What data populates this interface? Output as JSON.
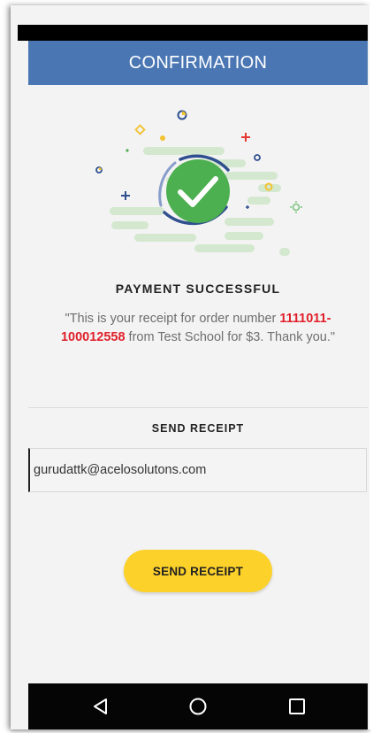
{
  "header": {
    "title": "CONFIRMATION"
  },
  "payment": {
    "status_title": "PAYMENT SUCCESSFUL",
    "message_prefix": "\"This is your receipt for order number ",
    "order_number": "1111011-100012558",
    "message_suffix": " from Test School for $3. Thank you.\""
  },
  "send_receipt": {
    "heading": "SEND RECEIPT",
    "email_value": "gurudattk@acelosolutons.com",
    "button_label": "SEND RECEIPT"
  },
  "navigation": {
    "items": [
      {
        "icon": "back-triangle-icon"
      },
      {
        "icon": "home-circle-icon"
      },
      {
        "icon": "recents-square-icon"
      }
    ]
  },
  "colors": {
    "header": "#4a77b4",
    "order_number": "#e0202a",
    "button": "#fcd12a",
    "check_circle": "#4caf50"
  }
}
